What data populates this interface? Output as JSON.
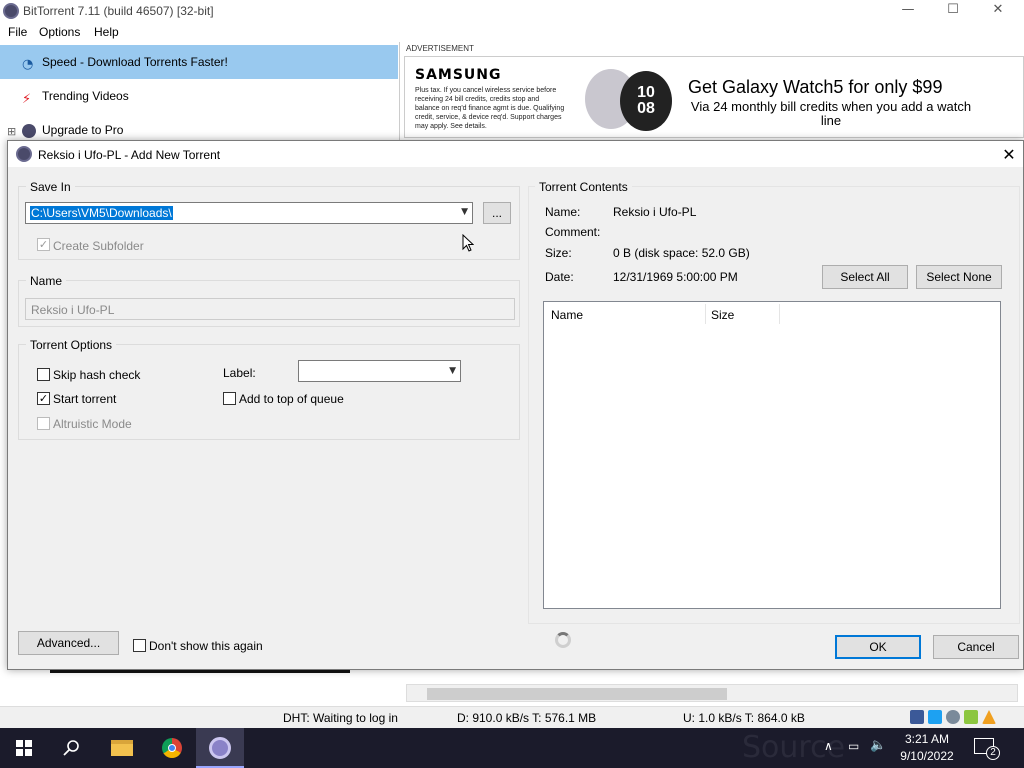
{
  "app": {
    "title": "BitTorrent 7.11  (build 46507) [32-bit]",
    "window_controls": {
      "minimize": "—",
      "maximize": "☐",
      "close": "✕"
    }
  },
  "menu": [
    "File",
    "Options",
    "Help"
  ],
  "sidebar": {
    "items": [
      {
        "label": "Speed - Download Torrents Faster!",
        "icon": "speed-gauge-icon",
        "selected": true
      },
      {
        "label": "Trending Videos",
        "icon": "lightning-icon"
      },
      {
        "label": "Upgrade to Pro",
        "icon": "bittorrent-icon",
        "expander": "⊞"
      }
    ]
  },
  "ad": {
    "label": "ADVERTISEMENT",
    "brand": "SAMSUNG",
    "fine_print": "Plus tax. If you cancel wireless service before receiving 24 bill credits, credits stop and balance on req'd finance agmt is due. Qualifying credit, service, & device req'd. Support charges may apply. See details.",
    "watch_time": "10\n08",
    "headline": "Get Galaxy Watch5 for only $99",
    "subline": "Via 24 monthly bill credits when you add a watch line"
  },
  "status": {
    "dht": "DHT: Waiting to log in",
    "download": "D: 910.0 kB/s T: 576.1 MB",
    "upload": "U: 1.0 kB/s T: 864.0 kB"
  },
  "taskbar": {
    "time": "3:21 AM",
    "date": "9/10/2022",
    "notifications": "2",
    "watermark": "Source"
  },
  "dialog": {
    "title": "Reksio i Ufo-PL - Add New Torrent",
    "save_in": {
      "group": "Save In",
      "path": "C:\\Users\\VM5\\Downloads\\",
      "browse": "...",
      "create_subfolder": "Create Subfolder",
      "create_subfolder_checked": true
    },
    "name": {
      "group": "Name",
      "value": "Reksio i Ufo-PL"
    },
    "options": {
      "group": "Torrent Options",
      "skip_hash": "Skip hash check",
      "skip_hash_checked": false,
      "start_torrent": "Start torrent",
      "start_torrent_checked": true,
      "altruistic": "Altruistic Mode",
      "altruistic_checked": false,
      "label": "Label:",
      "label_value": "",
      "add_top": "Add to top of queue",
      "add_top_checked": false
    },
    "contents": {
      "group": "Torrent Contents",
      "name_label": "Name:",
      "name_value": "Reksio i Ufo-PL",
      "comment_label": "Comment:",
      "comment_value": "",
      "size_label": "Size:",
      "size_value": "0 B (disk space: 52.0 GB)",
      "date_label": "Date:",
      "date_value": "12/31/1969 5:00:00 PM",
      "select_all": "Select All",
      "select_none": "Select None",
      "columns": [
        "Name",
        "Size"
      ]
    },
    "advanced": "Advanced...",
    "dont_show": "Don't show this again",
    "dont_show_checked": false,
    "ok": "OK",
    "cancel": "Cancel"
  }
}
